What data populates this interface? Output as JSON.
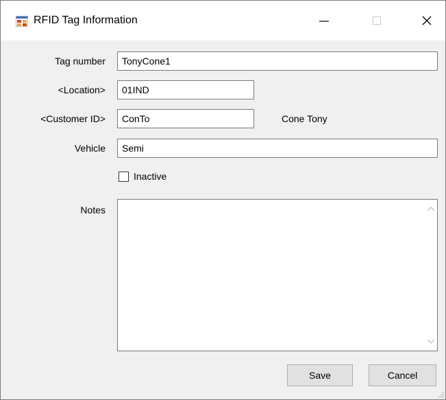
{
  "window": {
    "title": "RFID Tag Information",
    "icon": "app-window-icon",
    "controls": [
      "minimize-icon",
      "maximize-icon",
      "close-icon"
    ]
  },
  "form": {
    "tag_number": {
      "label": "Tag number",
      "value": "TonyCone1"
    },
    "location": {
      "label": "<Location>",
      "value": "01IND"
    },
    "customer_id": {
      "label": "<Customer ID>",
      "value": "ConTo",
      "name": "Cone Tony"
    },
    "vehicle": {
      "label": "Vehicle",
      "value": "Semi"
    },
    "inactive": {
      "label": "Inactive",
      "checked": false
    },
    "notes": {
      "label": "Notes",
      "value": ""
    }
  },
  "buttons": {
    "save": "Save",
    "cancel": "Cancel"
  }
}
